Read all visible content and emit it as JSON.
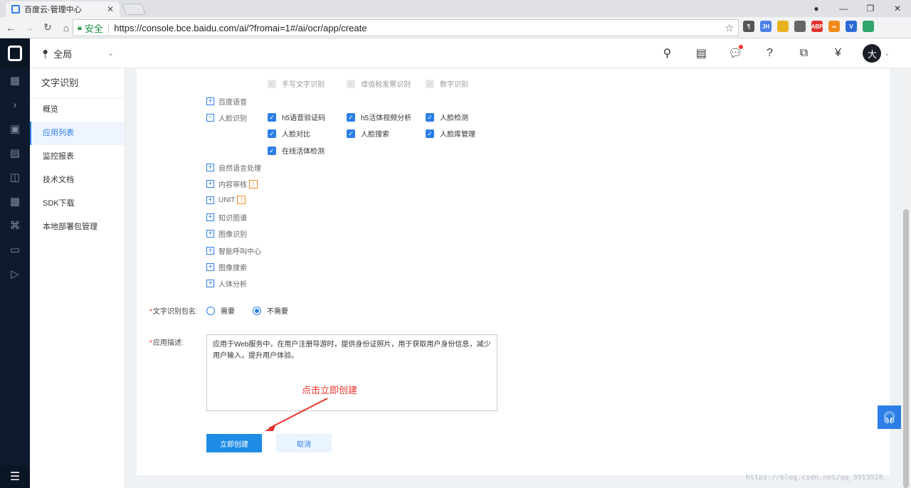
{
  "browser": {
    "tab_title": "百度云-管理中心",
    "secure_label": "安全",
    "url": "https://console.bce.baidu.com/ai/?fromai=1#/ai/ocr/app/create",
    "extensions": [
      {
        "name": "ext-paragraph",
        "label": "¶",
        "color": "#555555"
      },
      {
        "name": "ext-jh",
        "label": "JH",
        "color": "#4d7fe8"
      },
      {
        "name": "ext-colorful",
        "label": "",
        "color": "#e8b21f"
      },
      {
        "name": "ext-grid",
        "label": "",
        "color": "#666666"
      },
      {
        "name": "ext-abp",
        "label": "ABP",
        "color": "#e0342d"
      },
      {
        "name": "ext-infinity",
        "label": "∞",
        "color": "#f08a1d"
      },
      {
        "name": "ext-v",
        "label": "V",
        "color": "#2b6ad6"
      },
      {
        "name": "ext-globe",
        "label": "",
        "color": "#2fa76a"
      }
    ]
  },
  "topbar": {
    "region": "全局",
    "avatar": "大"
  },
  "sidemenu": {
    "title": "文字识别",
    "items": [
      "概览",
      "应用列表",
      "监控报表",
      "技术文档",
      "SDK下载",
      "本地部署包管理"
    ]
  },
  "ocr_sub": [
    "手写文字识别",
    "增值税发票识别",
    "数字识别"
  ],
  "services": {
    "speech": "百度语音",
    "face": "人脸识别",
    "face_items": [
      "h5语音验证码",
      "h5活体视频分析",
      "人脸检测",
      "人脸对比",
      "人脸搜索",
      "人脸库管理",
      "在线活体检测"
    ],
    "others": [
      "自然语言处理",
      "内容审核",
      "UNIT",
      "知识图谱",
      "图像识别",
      "智能呼叫中心",
      "图像搜索",
      "人体分析"
    ]
  },
  "form": {
    "package_label": "文字识别包名:",
    "need": "需要",
    "no_need": "不需要",
    "desc_label": "应用描述:",
    "description": "应用于Web服务中，在用户注册导游时，提供身份证照片，用于获取用户身份信息，减少用户输入，提升用户体验。",
    "annotation": "点击立即创建",
    "create": "立即创建",
    "cancel": "取消"
  },
  "watermark": "https://blog.csdn.net/qq_3913528"
}
